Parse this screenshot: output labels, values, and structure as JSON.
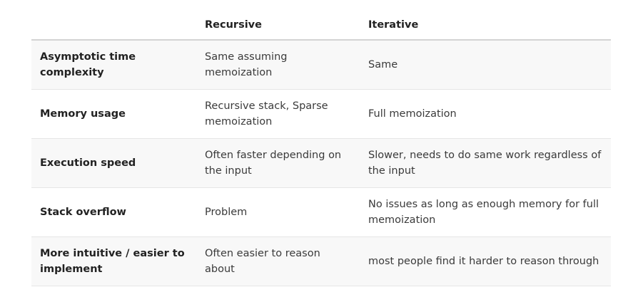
{
  "table": {
    "headers": [
      "",
      "Recursive",
      "Iterative"
    ],
    "rows": [
      {
        "label": "Asymptotic time complexity",
        "recursive": "Same assuming memoization",
        "iterative": "Same"
      },
      {
        "label": "Memory usage",
        "recursive": "Recursive stack, Sparse memoization",
        "iterative": "Full memoization"
      },
      {
        "label": "Execution speed",
        "recursive": "Often faster depending on the input",
        "iterative": "Slower, needs to do same work regardless of the input"
      },
      {
        "label": "Stack overflow",
        "recursive": "Problem",
        "iterative": "No issues as long as enough memory for full memoization"
      },
      {
        "label": "More intuitive / easier to implement",
        "recursive": "Often easier to reason about",
        "iterative": "most people find it harder to reason through"
      }
    ]
  },
  "colors": {
    "row_shade": "#f8f8f8",
    "header_rule": "#d3d3d3",
    "row_rule": "#e6e6e6",
    "text": "#3a3a3a",
    "heading_text": "#222222"
  }
}
